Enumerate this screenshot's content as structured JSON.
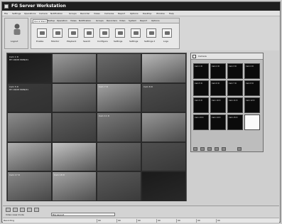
{
  "titlebar": {
    "title": "FG Server Workstation"
  },
  "menubar": {
    "items": [
      "File",
      "Settings",
      "Operations",
      "Camera",
      "Notification",
      "Groups",
      "Recorder",
      "Views",
      "Cameras",
      "Report",
      "Options",
      "Desktop",
      "Window",
      "Help"
    ]
  },
  "leftpanel": {
    "label": "Logout"
  },
  "toolbar": {
    "tabs": [
      "Quick Start",
      "Startup",
      "Operation",
      "Views",
      "Notification",
      "Groups",
      "Recorders",
      "Video",
      "System",
      "Report",
      "Options"
    ],
    "active_tab": "Quick Start",
    "buttons": [
      "Enable",
      "Monitor",
      "Playback",
      "Search",
      "Configure",
      "Settings",
      "Settings",
      "Settings 2",
      "Logs"
    ]
  },
  "cameras": {
    "tiles": [
      {
        "label": "Cam 1 D\nHH 18/08 MON/01",
        "bg": "#1a1a1a"
      },
      {
        "label": "",
        "bg": "#9c9c9c"
      },
      {
        "label": "",
        "bg": "#6b6b6b"
      },
      {
        "label": "",
        "bg": "#b8b8b8"
      },
      {
        "label": "Cam 5 D\nHH 18/08 MON/01",
        "bg": "#3a3a3a"
      },
      {
        "label": "",
        "bg": "#7e7e7e"
      },
      {
        "label": "Cam 7 D",
        "bg": "#a2a2a2"
      },
      {
        "label": "Cam 8 D",
        "bg": "#4d4d4d"
      },
      {
        "label": "",
        "bg": "#8c8c8c"
      },
      {
        "label": "",
        "bg": "#5e5e5e"
      },
      {
        "label": "Cam 11 D",
        "bg": "#7a7a7a"
      },
      {
        "label": "",
        "bg": "#979797"
      },
      {
        "label": "",
        "bg": "#b0b0b0"
      },
      {
        "label": "",
        "bg": "#c3c3c3"
      },
      {
        "label": "",
        "bg": "#6a6a6a"
      },
      {
        "label": "",
        "bg": "#505050"
      },
      {
        "label": "Cam 17 D",
        "bg": "#888888"
      },
      {
        "label": "Cam 18 D",
        "bg": "#a5a5a5"
      },
      {
        "label": "",
        "bg": "#5a5a5a"
      },
      {
        "label": "",
        "bg": "#1a1a1a"
      }
    ]
  },
  "sidepanel": {
    "title": "Camera",
    "cells": [
      "Cam 1 D",
      "Cam 2 D",
      "Cam 3 D",
      "Cam 4 D",
      "Cam 5 D",
      "Cam 6 D",
      "Cam 7 D",
      "Cam 8 D",
      "Cam 9 D",
      "Cam 10 D",
      "Cam 11 D",
      "Cam 12 D",
      "Cam 13 D",
      "Cam 14 D",
      "Cam 15 D",
      ""
    ]
  },
  "bottom": {
    "label": "Video view mode",
    "select_value": "Big Layout"
  },
  "statusbar": {
    "segments": [
      "Recording",
      "00",
      "00",
      "00",
      "00",
      "00",
      "00",
      "00"
    ]
  }
}
